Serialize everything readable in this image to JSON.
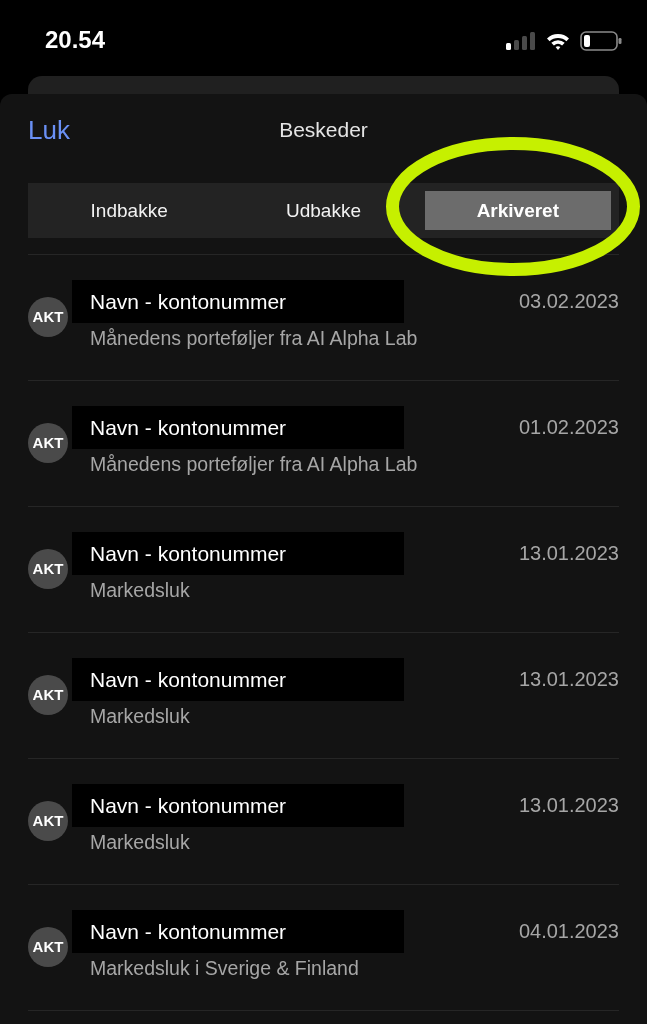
{
  "status_bar": {
    "time": "20.54"
  },
  "header": {
    "close": "Luk",
    "title": "Beskeder"
  },
  "tabs": [
    {
      "label": "Indbakke",
      "selected": false,
      "circled": false
    },
    {
      "label": "Udbakke",
      "selected": false,
      "circled": false
    },
    {
      "label": "Arkiveret",
      "selected": true,
      "circled": true
    }
  ],
  "messages": [
    {
      "avatar": "AKT",
      "sender": "Navn - kontonummer",
      "redacted": true,
      "subject": "Månedens porteføljer fra AI Alpha Lab",
      "date": "03.02.2023"
    },
    {
      "avatar": "AKT",
      "sender": "Navn - kontonummer",
      "redacted": true,
      "subject": "Månedens porteføljer fra AI Alpha Lab",
      "date": "01.02.2023"
    },
    {
      "avatar": "AKT",
      "sender": "Navn - kontonummer",
      "redacted": true,
      "subject": "Markedsluk",
      "date": "13.01.2023"
    },
    {
      "avatar": "AKT",
      "sender": "Navn - kontonummer",
      "redacted": true,
      "subject": "Markedsluk",
      "date": "13.01.2023"
    },
    {
      "avatar": "AKT",
      "sender": "Navn - kontonummer",
      "redacted": true,
      "subject": "Markedsluk",
      "date": "13.01.2023"
    },
    {
      "avatar": "AKT",
      "sender": "Navn - kontonummer",
      "redacted": true,
      "subject": "Markedsluk i Sverige & Finland",
      "date": "04.01.2023"
    }
  ]
}
